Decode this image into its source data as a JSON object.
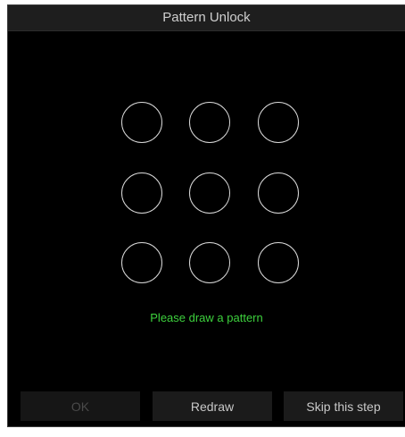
{
  "dialog": {
    "title": "Pattern Unlock",
    "hint": "Please draw a pattern",
    "hint_color": "#3dd13d",
    "pattern_nodes": 9
  },
  "buttons": {
    "ok_label": "OK",
    "redraw_label": "Redraw",
    "skip_label": "Skip this step"
  }
}
